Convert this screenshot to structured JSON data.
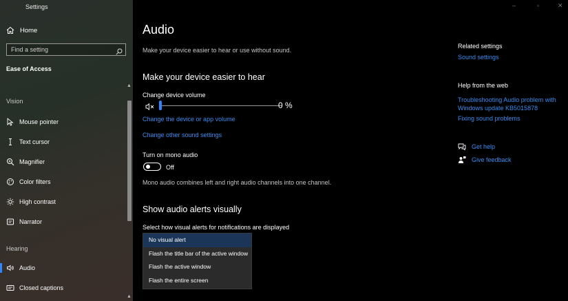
{
  "window": {
    "title": "Settings"
  },
  "sidebar": {
    "home_label": "Home",
    "search_placeholder": "Find a setting",
    "section_title": "Ease of Access",
    "groups": {
      "vision": "Vision",
      "hearing": "Hearing"
    },
    "items": [
      {
        "label": "Mouse pointer",
        "icon": "mouse-pointer-icon"
      },
      {
        "label": "Text cursor",
        "icon": "text-cursor-icon"
      },
      {
        "label": "Magnifier",
        "icon": "magnifier-icon"
      },
      {
        "label": "Color filters",
        "icon": "color-filters-icon"
      },
      {
        "label": "High contrast",
        "icon": "high-contrast-icon"
      },
      {
        "label": "Narrator",
        "icon": "narrator-icon"
      },
      {
        "label": "Audio",
        "icon": "audio-icon",
        "active": true
      },
      {
        "label": "Closed captions",
        "icon": "closed-captions-icon"
      }
    ]
  },
  "main": {
    "title": "Audio",
    "description": "Make your device easier to hear or use without sound.",
    "hear_section": {
      "heading": "Make your device easier to hear",
      "volume_label": "Change device volume",
      "volume_value": "0 %",
      "volume_level": 0,
      "link_app_volume": "Change the device or app volume",
      "link_other_sound": "Change other sound settings",
      "mono_label": "Turn on mono audio",
      "mono_state": "Off",
      "mono_description": "Mono audio combines left and right audio channels into one channel."
    },
    "alerts_section": {
      "heading": "Show audio alerts visually",
      "select_label": "Select how visual alerts for notifications are displayed",
      "options": [
        "No visual alert",
        "Flash the title bar of the active window",
        "Flash the active window",
        "Flash the entire screen"
      ],
      "selected_index": 0
    }
  },
  "right": {
    "related_heading": "Related settings",
    "related_link": "Sound settings",
    "web_heading": "Help from the web",
    "web_links": [
      "Troubleshooting Audio problem with Windows update KB5015878",
      "Fixing sound problems"
    ],
    "get_help": "Get help",
    "give_feedback": "Give feedback"
  },
  "colors": {
    "accent": "#2f86ff",
    "link": "#3a8cf0",
    "background": "#000000",
    "dropdown_selected": "#1a3558"
  }
}
